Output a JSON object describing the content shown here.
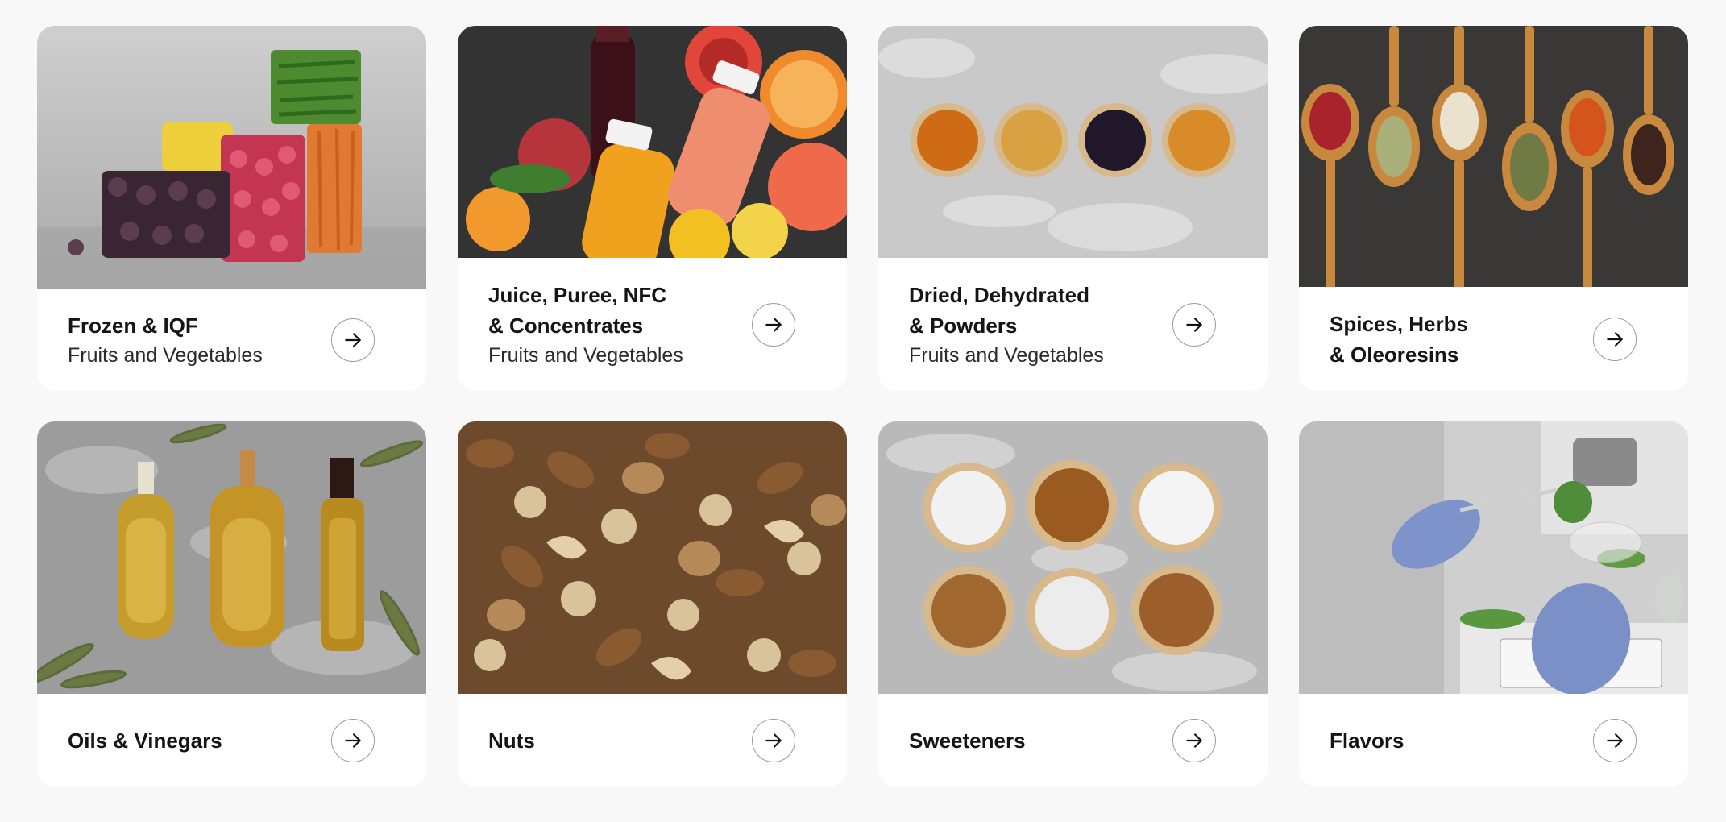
{
  "cards": [
    {
      "title": "Frozen & IQF",
      "subtitle": "Fruits and Vegetables",
      "image": "frozen-fruits-vegetables",
      "arrow_icon": "arrow-right-icon"
    },
    {
      "title": "Juice, Puree, NFC\n& Concentrates",
      "subtitle": "Fruits and Vegetables",
      "image": "juice-bottles-fruits",
      "arrow_icon": "arrow-right-icon"
    },
    {
      "title": "Dried, Dehydrated\n& Powders",
      "subtitle": "Fruits and Vegetables",
      "image": "dried-fruits-bowls",
      "arrow_icon": "arrow-right-icon"
    },
    {
      "title": "Spices, Herbs\n& Oleoresins",
      "subtitle": "",
      "image": "spices-wooden-spoons",
      "arrow_icon": "arrow-right-icon"
    },
    {
      "title": "Oils & Vinegars",
      "subtitle": "",
      "image": "oil-bottles-olive-branches",
      "arrow_icon": "arrow-right-icon"
    },
    {
      "title": "Nuts",
      "subtitle": "",
      "image": "mixed-nuts",
      "arrow_icon": "arrow-right-icon"
    },
    {
      "title": "Sweeteners",
      "subtitle": "",
      "image": "sugar-bowls",
      "arrow_icon": "arrow-right-icon"
    },
    {
      "title": "Flavors",
      "subtitle": "",
      "image": "lab-scientist-plant",
      "arrow_icon": "arrow-right-icon"
    }
  ],
  "colors": {
    "page_background": "#f8f8f8",
    "card_background": "#ffffff",
    "title_text": "#151515",
    "arrow_border": "#9a9a9a"
  }
}
